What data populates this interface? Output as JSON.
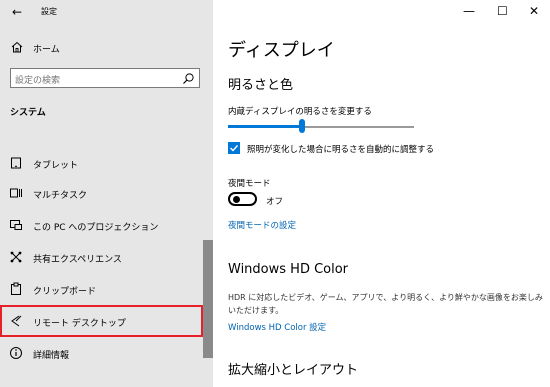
{
  "window": {
    "title": "設定"
  },
  "nav": {
    "back_glyph": "←",
    "home_label": "ホーム",
    "search_placeholder": "設定の検索",
    "section_label": "システム",
    "items": [
      {
        "label": "タブレット",
        "icon": "tablet-icon"
      },
      {
        "label": "マルチタスク",
        "icon": "multitasking-icon"
      },
      {
        "label": "この PC へのプロジェクション",
        "icon": "projection-icon"
      },
      {
        "label": "共有エクスペリエンス",
        "icon": "shared-experiences-icon"
      },
      {
        "label": "クリップボード",
        "icon": "clipboard-icon"
      },
      {
        "label": "リモート デスクトップ",
        "icon": "remote-desktop-icon"
      },
      {
        "label": "詳細情報",
        "icon": "info-icon"
      }
    ]
  },
  "controls": {
    "minimize": "—",
    "maximize": "☐",
    "close": "✕"
  },
  "main": {
    "title": "ディスプレイ",
    "brightness": {
      "heading": "明るさと色",
      "slider_label": "内蔵ディスプレイの明るさを変更する",
      "slider_value_fraction": 0.4,
      "auto_label": "照明が変化した場合に明るさを自動的に調整する",
      "auto_checked": true
    },
    "night": {
      "label": "夜間モード",
      "state": "オフ",
      "settings_link": "夜間モードの設定"
    },
    "hd_color": {
      "heading": "Windows HD Color",
      "description_line1": "HDR に対応したビデオ、ゲーム、アプリで、より明るく、より鮮やかな画像をお楽しみ",
      "description_line2": "いただけます。",
      "link": "Windows HD Color 設定"
    },
    "scale": {
      "heading": "拡大縮小とレイアウト"
    }
  },
  "colors": {
    "accent": "#0078d7",
    "highlight": "#e8202a",
    "link": "#0063b1"
  }
}
